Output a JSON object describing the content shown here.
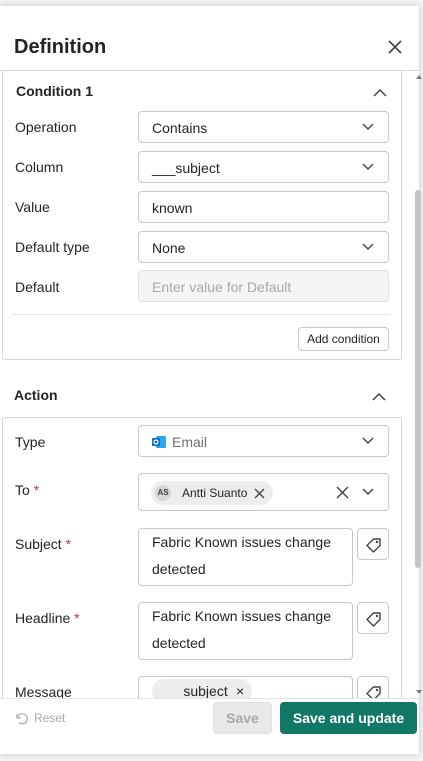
{
  "panel": {
    "title": "Definition"
  },
  "condition": {
    "title": "Condition 1",
    "fields": [
      {
        "label": "Operation",
        "value": "Contains"
      },
      {
        "label": "Column",
        "value": "___subject"
      },
      {
        "label": "Value",
        "value": "known"
      },
      {
        "label": "Default type",
        "value": "None"
      },
      {
        "label": "Default",
        "placeholder": "Enter value for Default"
      }
    ],
    "add_condition_label": "Add condition"
  },
  "action": {
    "title": "Action",
    "type": {
      "label": "Type",
      "value": "Email"
    },
    "to": {
      "label": "To",
      "required_mark": "*",
      "recipient_initials": "AS",
      "recipient_name": "Antti Suanto"
    },
    "subject": {
      "label": "Subject",
      "required_mark": "*",
      "value": "Fabric Known issues change detected"
    },
    "headline": {
      "label": "Headline",
      "required_mark": "*",
      "value": "Fabric Known issues change detected"
    },
    "message": {
      "label": "Message",
      "token": "___subject",
      "token_remove": "×"
    }
  },
  "footer": {
    "reset_label": "Reset",
    "save_label": "Save",
    "save_update_label": "Save and update"
  },
  "colors": {
    "primary": "#117865",
    "required": "#c4314b",
    "outlook_blue": "#0f6cbd"
  }
}
